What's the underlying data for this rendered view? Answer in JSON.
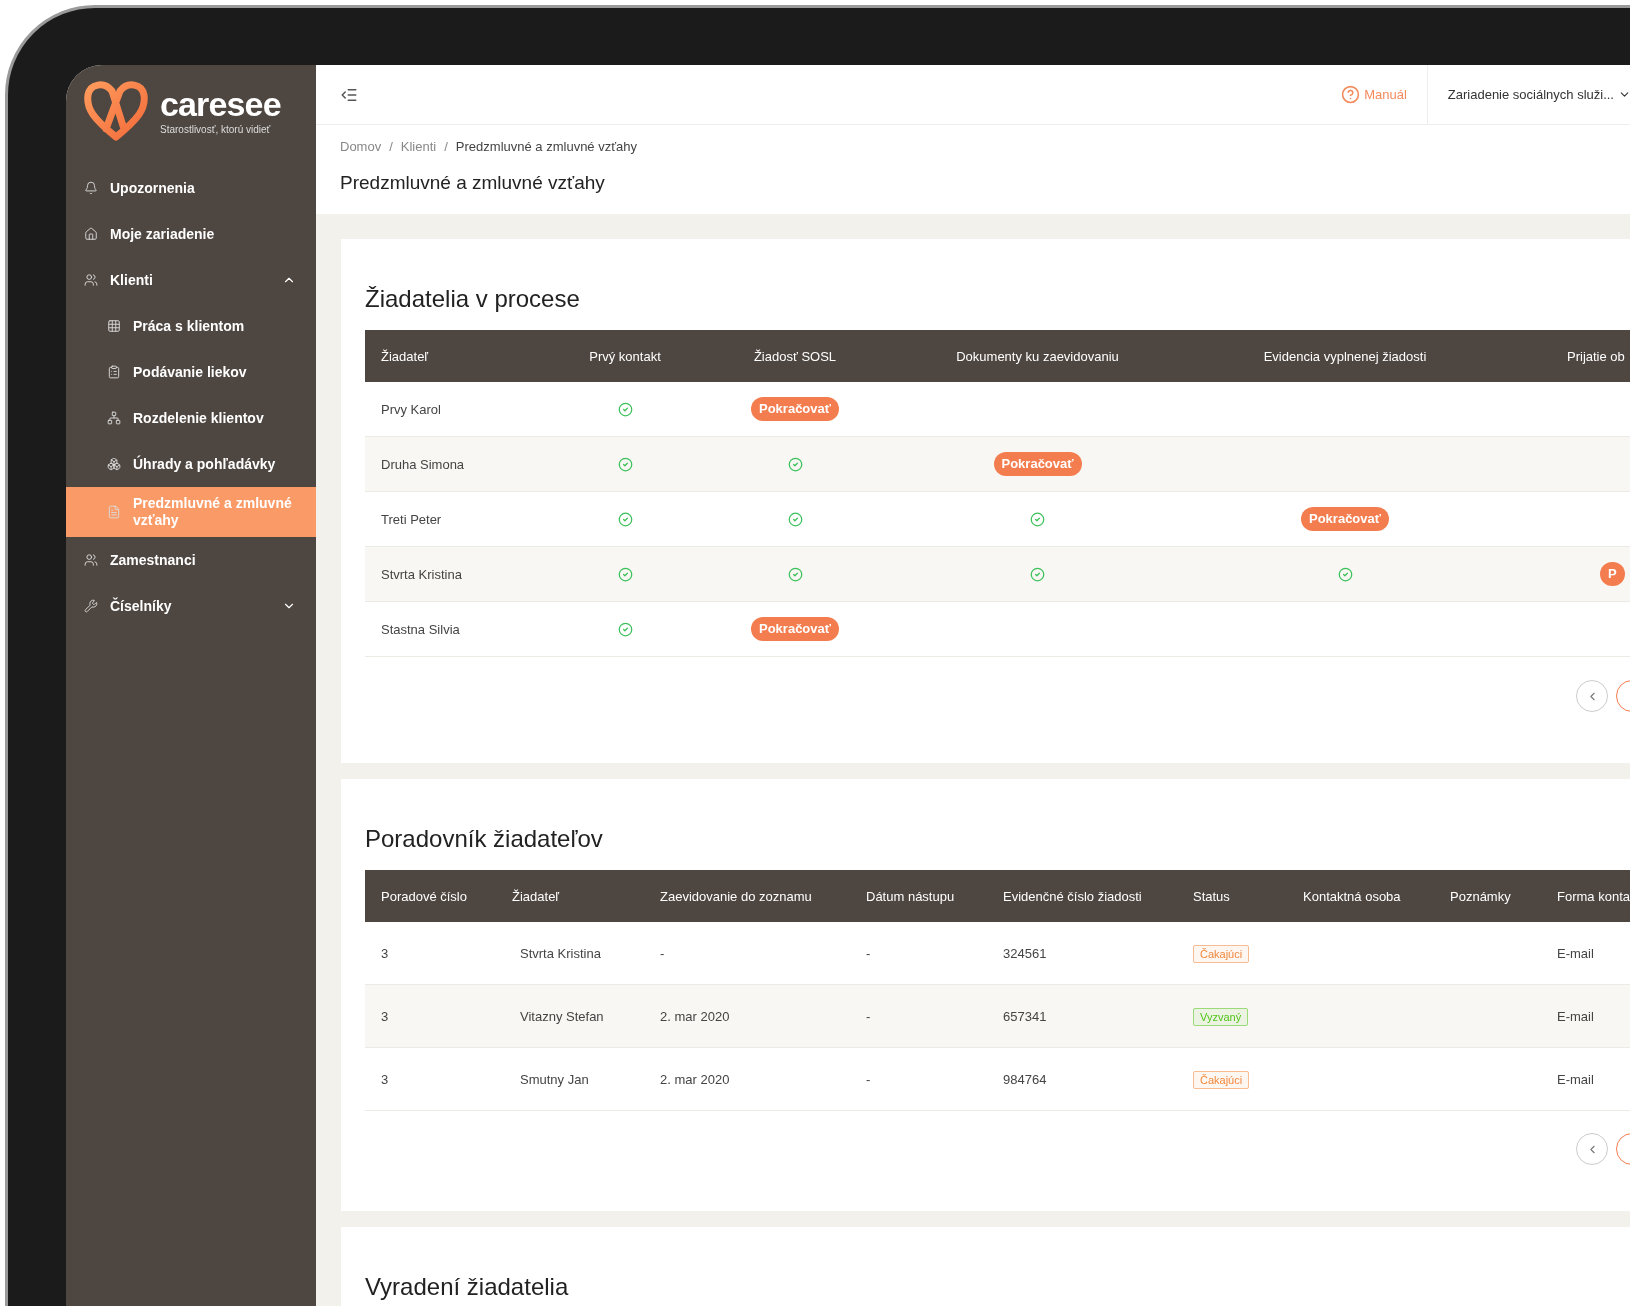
{
  "sidebar": {
    "logo": {
      "name": "caresee",
      "tagline": "Starostlivosť, ktorú vidieť"
    },
    "items": [
      {
        "label": "Upozornenia",
        "selected": false
      },
      {
        "label": "Moje zariadenie",
        "selected": false
      },
      {
        "label": "Klienti",
        "selected": false,
        "expanded": true,
        "children": [
          {
            "label": "Práca s klientom",
            "selected": false
          },
          {
            "label": "Podávanie liekov",
            "selected": false
          },
          {
            "label": "Rozdelenie klientov",
            "selected": false
          },
          {
            "label": "Úhrady a pohľadávky",
            "selected": false
          },
          {
            "label": "Predzmluvné a zmluvné vzťahy",
            "selected": true
          }
        ]
      },
      {
        "label": "Zamestnanci",
        "selected": false
      },
      {
        "label": "Číselníky",
        "selected": false,
        "expanded": false
      }
    ]
  },
  "header": {
    "manual": "Manuál",
    "facility": "Zariadenie sociálnych služi..."
  },
  "breadcrumb": {
    "separator": "/",
    "items": [
      "Domov",
      "Klienti",
      "Predzmluvné a zmluvné vzťahy"
    ]
  },
  "page_title": "Predzmluvné a zmluvné vzťahy",
  "applicants_in_process": {
    "title": "Žiadatelia v procese",
    "columns": [
      "Žiadateľ",
      "Prvý kontakt",
      "Žiadosť SOSL",
      "Dokumenty ku zaevidovaniu",
      "Evidencia vyplnenej žiadosti",
      "Prijatie ob"
    ],
    "rows": [
      {
        "name": "Prvy Karol",
        "steps": [
          {
            "kind": "done"
          },
          {
            "kind": "continue",
            "label": "Pokračovať"
          }
        ]
      },
      {
        "name": "Druha Simona",
        "steps": [
          {
            "kind": "done"
          },
          {
            "kind": "done"
          },
          {
            "kind": "continue",
            "label": "Pokračovať"
          }
        ]
      },
      {
        "name": "Treti Peter",
        "steps": [
          {
            "kind": "done"
          },
          {
            "kind": "done"
          },
          {
            "kind": "done"
          },
          {
            "kind": "continue",
            "label": "Pokračovať"
          }
        ]
      },
      {
        "name": "Stvrta Kristina",
        "steps": [
          {
            "kind": "done"
          },
          {
            "kind": "done"
          },
          {
            "kind": "done"
          },
          {
            "kind": "done"
          },
          {
            "kind": "continue",
            "label": "P"
          }
        ]
      },
      {
        "name": "Stastna Silvia",
        "steps": [
          {
            "kind": "done"
          },
          {
            "kind": "continue",
            "label": "Pokračovať"
          }
        ]
      }
    ]
  },
  "waiting_list": {
    "title": "Poradovník žiadateľov",
    "columns": [
      "Poradové číslo",
      "Žiadateľ",
      "Zaevidovanie do zoznamu",
      "Dátum nástupu",
      "Evidenčné číslo žiadosti",
      "Status",
      "Kontaktná osoba",
      "Poznámky",
      "Forma konta"
    ],
    "rows": [
      {
        "order": "3",
        "name": "Stvrta Kristina",
        "registered": "-",
        "start": "-",
        "number": "324561",
        "status": {
          "label": "Čakajúci",
          "color": "#f0883e"
        },
        "contact_form": "E-mail"
      },
      {
        "order": "3",
        "name": "Vitazny Stefan",
        "registered": "2. mar 2020",
        "start": "-",
        "number": "657341",
        "status": {
          "label": "Vyzvaný",
          "color": "#52c41a"
        },
        "contact_form": "E-mail"
      },
      {
        "order": "3",
        "name": "Smutny Jan",
        "registered": "2. mar 2020",
        "start": "-",
        "number": "984764",
        "status": {
          "label": "Čakajúci",
          "color": "#f0883e"
        },
        "contact_form": "E-mail"
      }
    ]
  },
  "removed_applicants": {
    "title": "Vyradení žiadatelia"
  }
}
